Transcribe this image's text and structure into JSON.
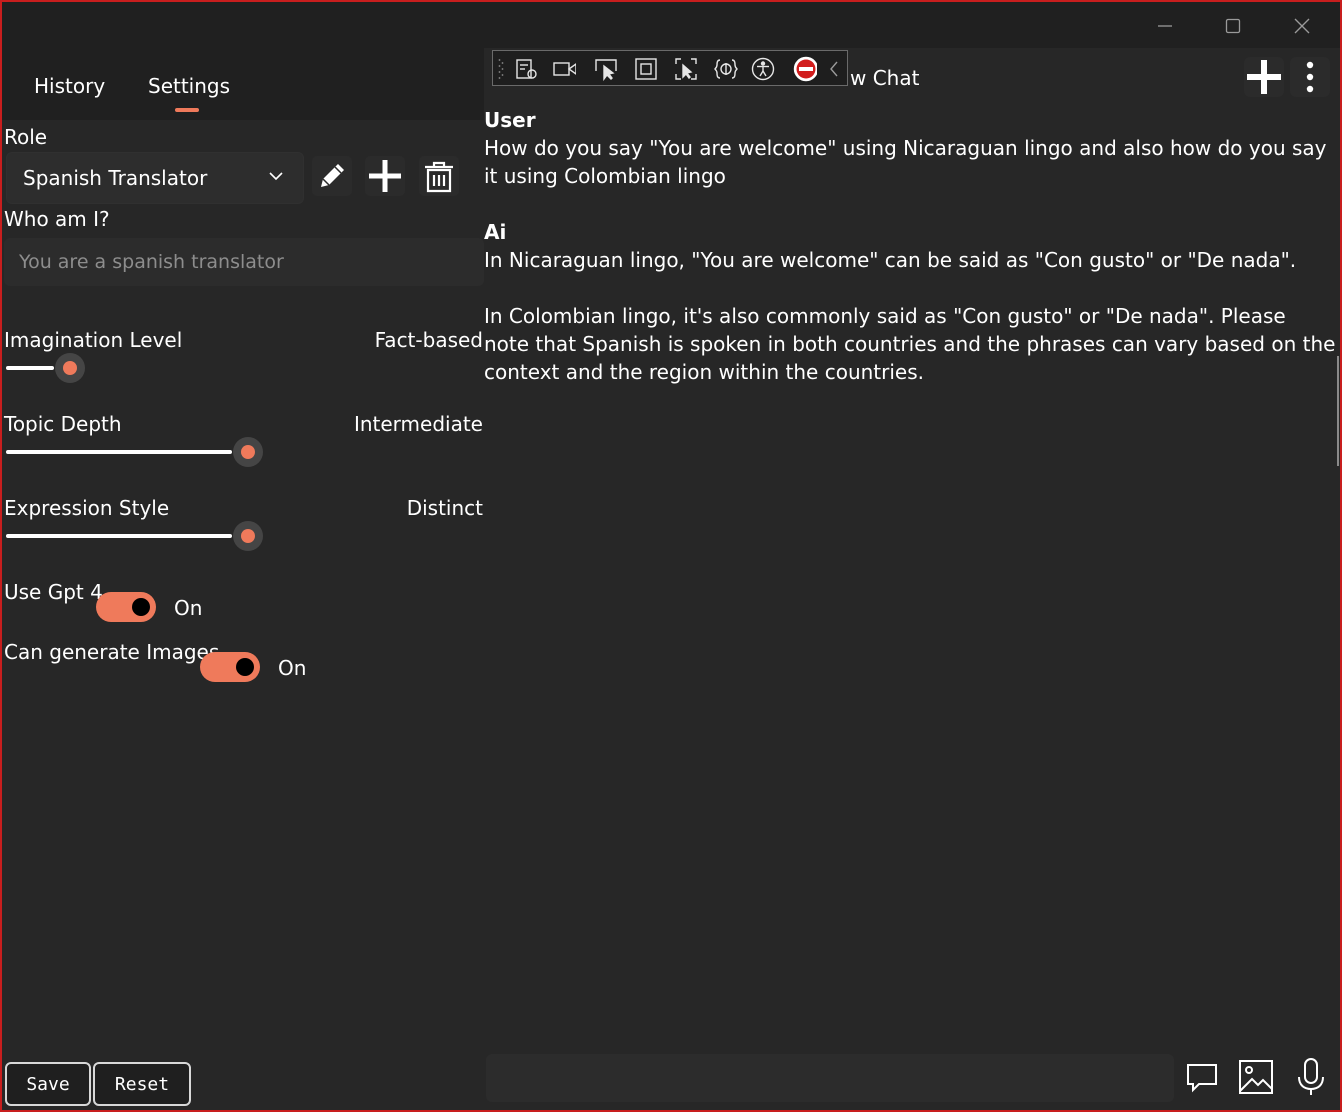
{
  "window": {
    "minimize_icon": "minimize-icon",
    "maximize_icon": "maximize-icon",
    "close_icon": "close-icon"
  },
  "left_panel": {
    "tabs": [
      {
        "label": "History"
      },
      {
        "label": "Settings",
        "active": true
      }
    ],
    "role": {
      "label": "Role",
      "selected": "Spanish Translator"
    },
    "who_am_i": {
      "label": "Who am I?",
      "placeholder": "You are a spanish translator"
    },
    "sliders": [
      {
        "label": "Imagination Level",
        "value_label": "Fact-based",
        "level": 0.2
      },
      {
        "label": "Topic Depth",
        "value_label": "Intermediate",
        "level": 1.0
      },
      {
        "label": "Expression Style",
        "value_label": "Distinct",
        "level": 1.0
      }
    ],
    "toggles": [
      {
        "label": "Use Gpt 4",
        "state": "On"
      },
      {
        "label": "Can generate Images",
        "state": "On"
      }
    ],
    "buttons": {
      "save": "Save",
      "reset": "Reset"
    }
  },
  "chat": {
    "title_partial": "w Chat",
    "messages": [
      {
        "sender": "User",
        "text": "How do you say \"You are welcome\" using Nicaraguan lingo and also how do you say it using Colombian lingo"
      },
      {
        "sender": "Ai",
        "paragraphs": [
          "In Nicaraguan lingo, \"You are welcome\" can be said as \"Con gusto\" or \"De nada\".",
          "In Colombian lingo, it's also commonly said as \"Con gusto\" or \"De nada\". Please note that Spanish is spoken in both countries and the phrases can vary based on the context and the region within the countries."
        ]
      }
    ],
    "input_value": ""
  },
  "debug_toolbar": {
    "icons": [
      "live-visual-tree-icon",
      "record-icon",
      "select-element-icon",
      "display-layout-adorners-icon",
      "track-focus-icon",
      "binding-failures-icon",
      "accessibility-icon",
      "hot-reload-stop-icon",
      "collapse-icon"
    ]
  },
  "colors": {
    "accent": "#ef7a5b",
    "background": "#272727",
    "panel": "#202020",
    "border": "#c81e1e"
  }
}
